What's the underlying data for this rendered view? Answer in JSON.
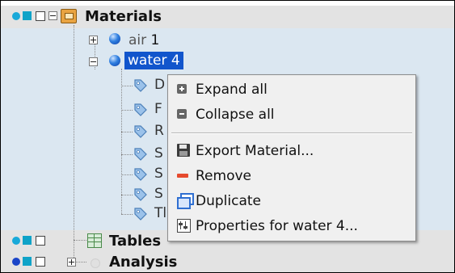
{
  "tree": {
    "materials": {
      "label": "Materials",
      "icon": "materials-folder-icon",
      "children": [
        {
          "name": "air",
          "number": "1",
          "icon": "sphere-icon"
        },
        {
          "name": "water",
          "number": "4",
          "icon": "sphere-icon",
          "selected": true
        }
      ]
    },
    "water_children": [
      {
        "label": "D",
        "icon": "property-tag-icon"
      },
      {
        "label": "F",
        "icon": "property-tag-icon"
      },
      {
        "label": "R",
        "icon": "property-tag-icon"
      },
      {
        "label": "S",
        "icon": "property-tag-icon"
      },
      {
        "label": "S",
        "icon": "property-tag-icon"
      },
      {
        "label": "S",
        "icon": "property-tag-icon"
      },
      {
        "label": "Tl",
        "icon": "property-tag-icon"
      }
    ],
    "tables": {
      "label": "Tables",
      "icon": "table-icon"
    },
    "analysis": {
      "label": "Analysis",
      "icon": "analysis-icon"
    }
  },
  "context_menu": {
    "items": [
      {
        "label": "Expand all",
        "icon": "expand-all-icon"
      },
      {
        "label": "Collapse all",
        "icon": "collapse-all-icon"
      },
      {
        "label": "Export Material...",
        "icon": "floppy-disk-icon"
      },
      {
        "label": "Remove",
        "icon": "remove-icon"
      },
      {
        "label": "Duplicate",
        "icon": "duplicate-icon"
      },
      {
        "label": "Properties for water 4...",
        "icon": "properties-icon"
      }
    ]
  },
  "colors": {
    "header_row_bg": "#e3e3e3",
    "selected_branch_bg": "#dbe7f1",
    "selection_bg": "#1155cc",
    "selection_text": "#ffffff",
    "menu_bg": "#f0f0f0",
    "indicator_cyan": "#19a9d9"
  }
}
